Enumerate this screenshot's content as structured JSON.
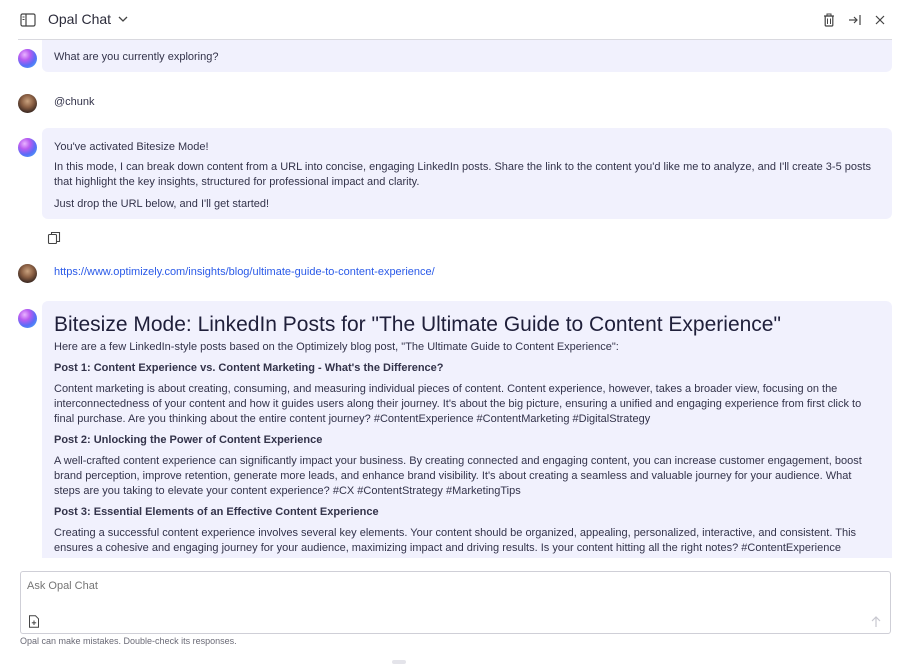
{
  "header": {
    "title": "Opal Chat"
  },
  "messages": {
    "m0": {
      "text": "What are you currently exploring?"
    },
    "m1": {
      "text": "@chunk"
    },
    "m2": {
      "line1": "You've activated Bitesize Mode!",
      "line2": "In this mode, I can break down content from a URL into concise, engaging LinkedIn posts. Share the link to the content you'd like me to analyze, and I'll create 3-5 posts that highlight the key insights, structured for professional impact and clarity.",
      "line3": "Just drop the URL below, and I'll get started!"
    },
    "m3": {
      "url": "https://www.optimizely.com/insights/blog/ultimate-guide-to-content-experience/"
    },
    "m4": {
      "heading": "Bitesize Mode: LinkedIn Posts for \"The Ultimate Guide to Content Experience\"",
      "intro": "Here are a few LinkedIn-style posts based on the Optimizely blog post, \"The Ultimate Guide to Content Experience\":",
      "posts": [
        {
          "title": "Post 1: Content Experience vs. Content Marketing - What's the Difference?",
          "body": "Content marketing is about creating, consuming, and measuring individual pieces of content. Content experience, however, takes a broader view, focusing on the interconnectedness of your content and how it guides users along their journey. It's about the big picture, ensuring a unified and engaging experience from first click to final purchase. Are you thinking about the entire content journey? #ContentExperience #ContentMarketing #DigitalStrategy"
        },
        {
          "title": "Post 2: Unlocking the Power of Content Experience",
          "body": "A well-crafted content experience can significantly impact your business. By creating connected and engaging content, you can increase customer engagement, boost brand perception, improve retention, generate more leads, and enhance brand visibility. It's about creating a seamless and valuable journey for your audience. What steps are you taking to elevate your content experience? #CX #ContentStrategy #MarketingTips"
        },
        {
          "title": "Post 3: Essential Elements of an Effective Content Experience",
          "body": "Creating a successful content experience involves several key elements. Your content should be organized, appealing, personalized, interactive, and consistent. This ensures a cohesive and engaging journey for your audience, maximizing impact and driving results. Is your content hitting all the right notes? #ContentExperience"
        }
      ]
    }
  },
  "input": {
    "placeholder": "Ask Opal Chat"
  },
  "disclaimer": "Opal can make mistakes. Double-check its responses.",
  "colors": {
    "bubble": "#f1f1fd",
    "link": "#2a5ae8",
    "accent": "#5a6cf7"
  },
  "icons": [
    "sidebar-toggle-icon",
    "chevron-down-icon",
    "trash-icon",
    "collapse-panel-icon",
    "close-icon",
    "copy-icon",
    "attach-file-icon",
    "send-icon"
  ]
}
